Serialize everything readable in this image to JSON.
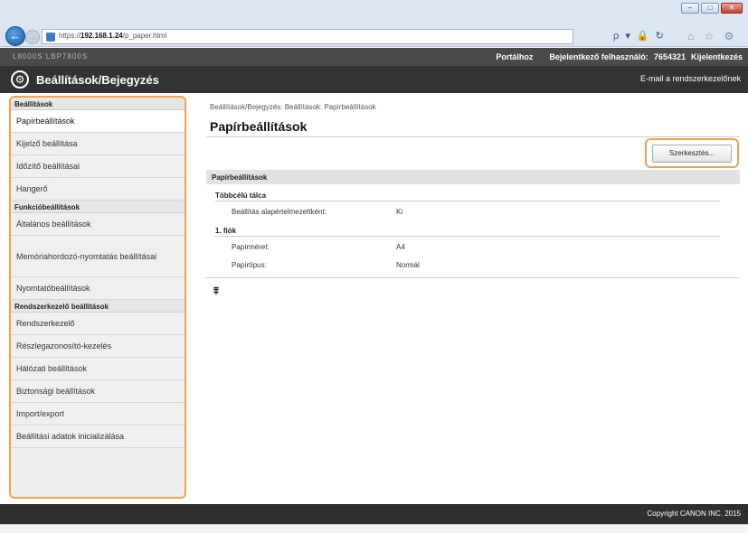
{
  "browser": {
    "url_prefix": "https://",
    "url_host": "192.168.1.24",
    "url_path": "/p_paper.html",
    "address_controls": "ρ ▾ 🔒 ↻",
    "nav_icons": "⌂ ☆ ⚙",
    "window_buttons": [
      "–",
      "□",
      "✕"
    ]
  },
  "topbar": {
    "brand": "L8000S LBP7800S",
    "portal_link": "Portálhoz",
    "user_label": "Bejelentkező felhasználó:",
    "user_value": "7654321",
    "logout": "Kijelentkezés"
  },
  "header": {
    "title": "Beállítások/Bejegyzés",
    "email_link": "E-mail a rendszerkezelőnek"
  },
  "sidebar": {
    "section1": "Beállítások",
    "items1": [
      "Papírbeállítások",
      "Kijelző beállítása",
      "Időzítő beállításai",
      "Hangerő"
    ],
    "section2": "Funkcióbeállítások",
    "items2": [
      "Általános beállítások",
      "Memóriahordozó-nyomtatás beállításai",
      "Nyomtatóbeállítások"
    ],
    "section3": "Rendszerkezelő beállítások",
    "items3": [
      "Rendszerkezelő",
      "Részlegazonosító-kezelés",
      "Hálózati beállítások",
      "Biztonsági beállítások",
      "Import/export",
      "Beállítási adatok inicializálása"
    ]
  },
  "main": {
    "breadcrumb": "Beállítások/Bejegyzés: Beállítások: Papírbeállítások",
    "title": "Papírbeállítások",
    "edit_button": "Szerkesztés...",
    "section_header": "Papírbeállítások",
    "group1_title": "Többcélú tálca",
    "group1_label": "Beállítás alapértelmezettként:",
    "group1_value": "Ki",
    "group2_title": "1. fiók",
    "paper_size_label": "Papírméret:",
    "paper_size_value": "A4",
    "paper_type_label": "Papírtípus:",
    "paper_type_value": "Normál",
    "top_icon": "⩱"
  },
  "footer": {
    "copyright": "Copyright CANON INC. 2015"
  }
}
